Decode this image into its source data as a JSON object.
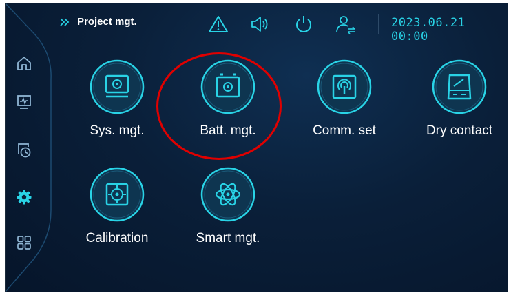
{
  "header": {
    "title": "Project mgt.",
    "datetime": "2023.06.21 00:00",
    "icons": [
      "double-chevron-icon",
      "warning-icon",
      "speaker-icon",
      "power-icon",
      "user-switch-icon"
    ]
  },
  "sidebar": {
    "items": [
      {
        "icon": "home-icon"
      },
      {
        "icon": "monitor-icon"
      },
      {
        "icon": "history-icon"
      },
      {
        "icon": "settings-icon",
        "active": true
      },
      {
        "icon": "apps-grid-icon"
      }
    ]
  },
  "tiles": [
    {
      "label": "Sys. mgt.",
      "icon": "system-settings-icon"
    },
    {
      "label": "Batt. mgt.",
      "icon": "battery-settings-icon"
    },
    {
      "label": "Comm. set",
      "icon": "communication-icon"
    },
    {
      "label": "Dry contact",
      "icon": "dry-contact-icon"
    },
    {
      "label": "Calibration",
      "icon": "calibration-icon"
    },
    {
      "label": "Smart mgt.",
      "icon": "smart-atom-icon"
    }
  ],
  "colors": {
    "accent": "#29d3e6",
    "background": "#0a1f39",
    "highlight": "#e00000",
    "text": "#ffffff"
  }
}
